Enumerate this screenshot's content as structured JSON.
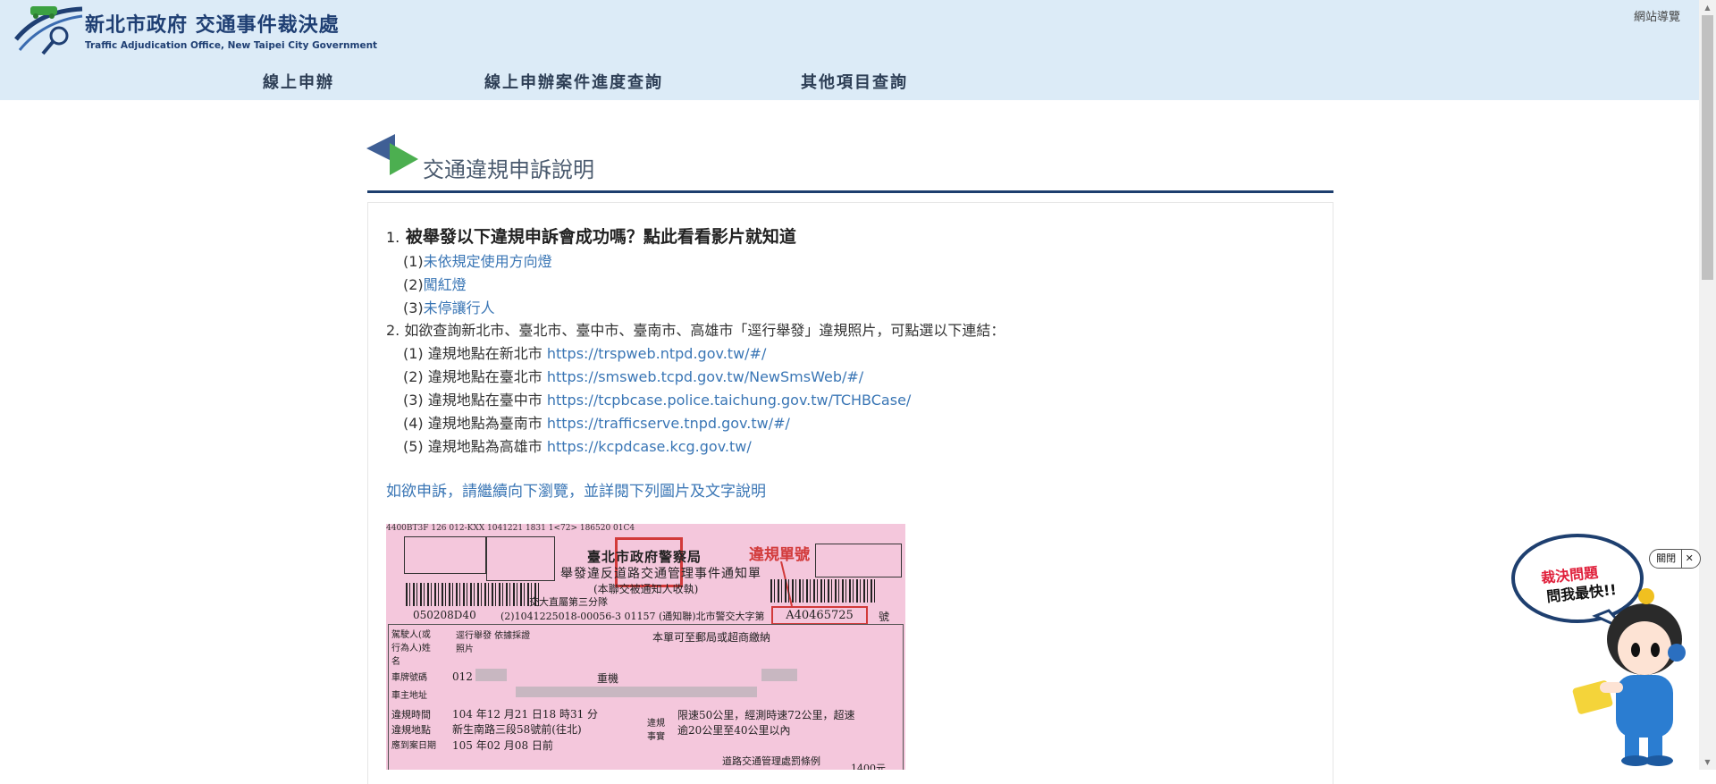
{
  "header": {
    "title": "新北市政府 交通事件裁決處",
    "subtitle": "Traffic Adjudication Office, New Taipei City Government",
    "sitemap": "網站導覽",
    "nav": [
      "線上申辦",
      "線上申辦案件進度查詢",
      "其他項目查詢"
    ]
  },
  "section": {
    "title": "交通違規申訴說明"
  },
  "content": {
    "item1_num": "1.",
    "item1_title": "被舉發以下違規申訴會成功嗎？點此看看影片就知道",
    "videos": [
      {
        "prefix": "(1)",
        "label": "未依規定使用方向燈"
      },
      {
        "prefix": "(2)",
        "label": "闖紅燈"
      },
      {
        "prefix": "(3)",
        "label": "未停讓行人"
      }
    ],
    "item2_text": "2. 如欲查詢新北市、臺北市、臺中市、臺南市、高雄市「逕行舉發」違規照片，可點選以下連結：",
    "links": [
      {
        "prefix": "(1) 違規地點在新北市",
        "url": "https://trspweb.ntpd.gov.tw/#/"
      },
      {
        "prefix": "(2) 違規地點在臺北市",
        "url": "https://smsweb.tcpd.gov.tw/NewSmsWeb/#/"
      },
      {
        "prefix": "(3) 違規地點在臺中市",
        "url": "https://tcpbcase.police.taichung.gov.tw/TCHBCase/"
      },
      {
        "prefix": "(4) 違規地點為臺南市",
        "url": "https://trafficserve.tnpd.gov.tw/#/"
      },
      {
        "prefix": "(5) 違規地點為高雄市",
        "url": "https://kcpdcase.kcg.gov.tw/"
      }
    ],
    "notice": "如欲申訴，請繼續向下瀏覽，並詳閱下列圖片及文字說明"
  },
  "ticket": {
    "top_code": "4400BT3F 126 012-KXX 1041221 1831 1<72> 186520 01C4",
    "title1": "臺北市政府警察局",
    "title2": "舉發違反道路交通管理事件通知單",
    "title3": "(本聯交被通知人收執)",
    "red_label": "違規單號",
    "ticket_no": "A40465725",
    "code_left": "050208D40",
    "code_mid": "(2)1041225018-00056-3 01157 (通知聯)北市警交大字第",
    "suffix": "號",
    "dept": "交大直屬第三分隊",
    "driver_label": "駕駛人(或行為人)姓名",
    "driver_value": "逕行舉發 依據採證照片",
    "address_note": "本單可至郵局或超商繳納",
    "plate_label": "車牌號碼",
    "plate_value": "012",
    "vehicle": "重機",
    "owner_label": "車主地址",
    "time_label": "違規時間",
    "time_value": "104 年12 月21 日18 時31 分",
    "place_label": "違規地點",
    "place_value": "新生南路三段58號前(往北)",
    "due_label": "應到案日期",
    "due_value": "105 年02 月08 日前",
    "fact_label": "違規事實",
    "fact_value1": "限速50公里，經測時速72公里，超速",
    "fact_value2": "逾20公里至40公里以內",
    "law_label": "道路交通管理處罰條例",
    "fine": "1400元"
  },
  "bot": {
    "line1": "裁決問題",
    "line2": "問我最快!!",
    "close_label": "關閉",
    "close_x": "✕"
  }
}
